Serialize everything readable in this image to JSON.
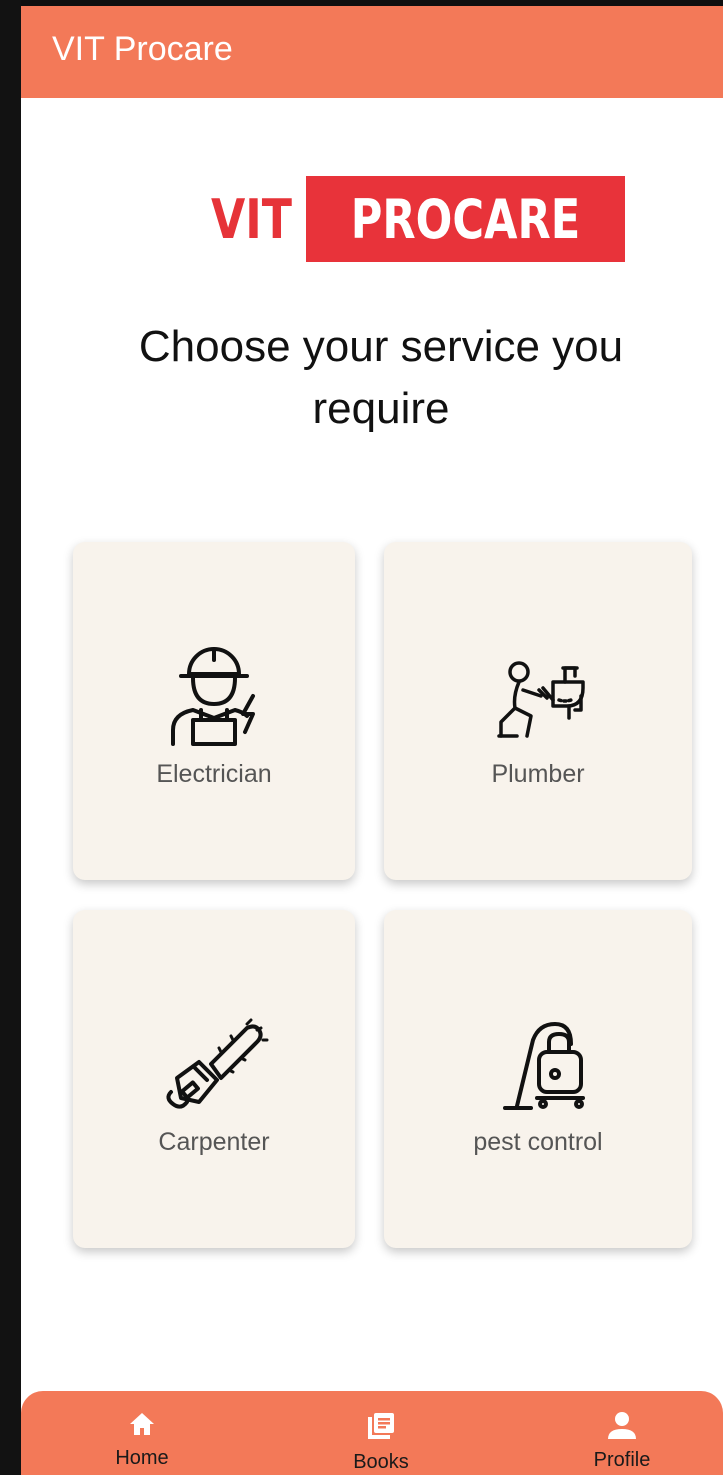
{
  "appbar": {
    "title": "VIT Procare"
  },
  "logo": {
    "left_text": "VIT",
    "right_text": "PROCARE"
  },
  "headline": "Choose your service you require",
  "services": [
    {
      "label": "Electrician",
      "icon": "electrician-icon"
    },
    {
      "label": "Plumber",
      "icon": "plumber-icon"
    },
    {
      "label": "Carpenter",
      "icon": "chainsaw-icon"
    },
    {
      "label": "pest control",
      "icon": "vacuum-icon"
    }
  ],
  "nav": [
    {
      "label": "Home",
      "icon": "home-icon"
    },
    {
      "label": "Books",
      "icon": "books-icon"
    },
    {
      "label": "Profile",
      "icon": "profile-icon"
    }
  ],
  "colors": {
    "primary": "#f37958",
    "logo_red": "#e8333a",
    "card_bg": "#f8f3ec"
  }
}
